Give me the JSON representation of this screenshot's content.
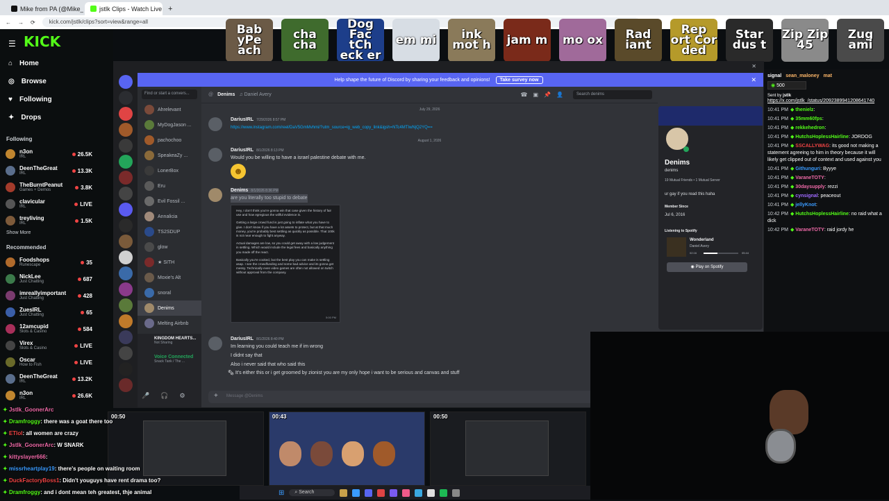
{
  "browser": {
    "tabs": [
      {
        "label": "Mike from PA (@Mike_from_PA",
        "active": false,
        "color": "#111"
      },
      {
        "label": "jstlk Clips - Watch Live on Kick",
        "active": true,
        "color": "#53fc18"
      }
    ],
    "url": "kick.com/jstlk/clips?sort=view&range=all",
    "colors": {
      "chrome": "#dfe3e8"
    }
  },
  "kick": {
    "brand": "KICK",
    "accent": "#53fc18",
    "nav": [
      {
        "label": "Home",
        "icon": "home-icon"
      },
      {
        "label": "Browse",
        "icon": "compass-icon"
      },
      {
        "label": "Following",
        "icon": "heart-icon"
      },
      {
        "label": "Drops",
        "icon": "gift-icon"
      }
    ],
    "following_title": "Following",
    "following": [
      {
        "name": "n3on",
        "cat": "IRL",
        "viewers": "26.5K",
        "color": "#c0862f"
      },
      {
        "name": "DeenTheGreat",
        "cat": "IRL",
        "viewers": "13.3K",
        "color": "#5a6e8c"
      },
      {
        "name": "TheBurntPeanut",
        "cat": "Games + Demos",
        "viewers": "3.8K",
        "color": "#a33b2b"
      },
      {
        "name": "clavicular",
        "cat": "IRL",
        "viewers": "LIVE",
        "color": "#555"
      },
      {
        "name": "treyliving",
        "cat": "IRL",
        "viewers": "1.5K",
        "color": "#7d5a3a"
      }
    ],
    "show_more": "Show More",
    "recommended_title": "Recommended",
    "recommended": [
      {
        "name": "Foodshops",
        "cat": "Runescape",
        "viewers": "35",
        "color": "#b06a2b"
      },
      {
        "name": "NickLee",
        "cat": "Just Chatting",
        "viewers": "687",
        "color": "#3b7a4a"
      },
      {
        "name": "imreallyimportant",
        "cat": "Just Chatting",
        "viewers": "428",
        "color": "#7a3b6e"
      },
      {
        "name": "ZuesIRL",
        "cat": "Just Chatting",
        "viewers": "65",
        "color": "#3a5ea8"
      },
      {
        "name": "12amcupid",
        "cat": "Slots & Casino",
        "viewers": "584",
        "color": "#a82f5a"
      },
      {
        "name": "Virex",
        "cat": "Slots & Casino",
        "viewers": "LIVE",
        "color": "#444"
      },
      {
        "name": "Oscar",
        "cat": "How to Fish",
        "viewers": "LIVE",
        "color": "#6a6a2a"
      },
      {
        "name": "DeenTheGreat",
        "cat": "IRL",
        "viewers": "13.2K",
        "color": "#5a6e8c"
      },
      {
        "name": "n3on",
        "cat": "IRL",
        "viewers": "26.6K",
        "color": "#c0862f"
      }
    ]
  },
  "overlay_emotes": [
    {
      "text": "Bab yPe ach",
      "color": "#6b5a46"
    },
    {
      "text": "cha cha",
      "color": "#3f6b2d"
    },
    {
      "text": "Dog Fac tCh eck er",
      "color": "#1d3e8a"
    },
    {
      "text": "em mi",
      "color": "#d7dde4"
    },
    {
      "text": "ink mot h",
      "color": "#8a7a5a"
    },
    {
      "text": "jam m",
      "color": "#7a2a1a"
    },
    {
      "text": "mo ox",
      "color": "#a06a9a"
    },
    {
      "text": "Rad iant",
      "color": "#5a4a2a"
    },
    {
      "text": "Rep ort Cor ded",
      "color": "#b59a2a"
    },
    {
      "text": "Star dus t",
      "color": "#2a2a2a"
    },
    {
      "text": "Zip Zip 45",
      "color": "#8a8a8a"
    },
    {
      "text": "Zug ami",
      "color": "#4a4a4a"
    }
  ],
  "discord": {
    "banner": "Help shape the future of Discord by sharing your feedback and opinions!",
    "banner_button": "Take survey now",
    "search_dm": "Find or start a convers...",
    "dms": [
      {
        "name": "Ahrelevant",
        "color": "#7a4a3a"
      },
      {
        "name": "MyDogJason ...",
        "color": "#5a7a3a"
      },
      {
        "name": "pachochoo",
        "color": "#a05a2a"
      },
      {
        "name": "SpeakeaZy ...",
        "color": "#8a6a3a"
      },
      {
        "name": "LonerBox",
        "color": "#3a3a3a"
      },
      {
        "name": "Eru",
        "color": "#5a5a5a"
      },
      {
        "name": "Evil Fossil ...",
        "color": "#6a6a6a"
      },
      {
        "name": "Annalicia",
        "color": "#a08a7a"
      },
      {
        "name": "TS2SDUP",
        "color": "#2a4a8a"
      },
      {
        "name": "glow",
        "color": "#4a4a4a"
      },
      {
        "name": "★ SITH",
        "color": "#7a2a2a"
      },
      {
        "name": "Moxie's Alt",
        "color": "#6a5a4a"
      },
      {
        "name": "snoral",
        "color": "#3a6aa8"
      },
      {
        "name": "Denims",
        "color": "#a08a6a"
      },
      {
        "name": "Melting Airbnb",
        "color": "#6a6a8a"
      }
    ],
    "active_dm_sub": "Daniel Avery",
    "melting_sub": "10 Members",
    "server_name": "KINGDOM HEARTS...",
    "server_sub": "Not Sharing",
    "voice_label": "Voice Connected",
    "voice_sub": "Snack Tank / The ...",
    "chat_header": "Denims",
    "chat_header_sub": "Daniel Avery",
    "search_placeholder": "Search denims",
    "date1": "July 29, 2026",
    "date2": "August 1, 2026",
    "msg1_author": "DariusIRL",
    "msg1_time": "7/29/2026 8:57 PM",
    "msg1_text": "https://www.instagram.com/reel/DaV5GmMvhmi/?utm_source=ig_web_copy_link&igsh=NTc4MTIwNjQ2YQ==",
    "msg2_author": "DariusIRL",
    "msg2_time": "8/1/2026 8:13 PM",
    "msg2_text": "Would you be willing to have a israel palestine debate with me.",
    "msg3_author": "Denims",
    "msg3_time": "8/1/2026 8:36 PM",
    "msg3_text": "are you literally too stupid to debate",
    "note_p1": "Hey, I don't think you're gonna win that case given the history of fair use and how egregious the willful evidence is.",
    "note_p2": "Getting a large crowd fund is just going to inflate what you have to give. I don't know if you have a lot assets to protect, but at that much money, you're probably best settling as quickly as possible. That 100k is not near enough to fight anyway.",
    "note_p3": "Actual damages are low, so you could get away with a low judgement in settling. Which would include the legal fees and basically anything you made off the react.",
    "note_p4": "Basically you're cooked, but the best play you can make is settling asap. I see the crowdfunding and some bad advice and its gonna get messy. Technically even video games are often not allowed on twitch without approval from the company.",
    "note_time": "5:00 PM",
    "msg4_author": "DariusIRL",
    "msg4_time": "8/1/2026 8:40 PM",
    "msg4_lines": [
      "Im learning you could teach me if im wrong",
      "I didnt say that",
      "Also i never said that who said this",
      "It's either this or i get groomed by zionist you are my only hope i want to be serious and canvas and stuff"
    ],
    "message_placeholder": "Message @Denims",
    "profile": {
      "name": "Denims",
      "handle": "denims",
      "mutuals": "19 Mutual Friends • 1 Mutual Server",
      "bio": "ur gay if you read this haha",
      "member_since_label": "Member Since",
      "member_since": "Jul 6, 2016",
      "listening_label": "Listening to Spotify",
      "song": "Wonderland",
      "artist": "Daniel Avery",
      "elapsed": "02:16",
      "duration": "05:44",
      "progress": 0.4,
      "play_button": "Play on Spotify"
    },
    "accent": "#5865f2"
  },
  "kick_chat": {
    "top_user": "sean_maloney",
    "top_user2": "mat",
    "pinned_label": "signal",
    "sub_count": "500",
    "sent_by": "Sent by",
    "sent_by_user": "jstlk",
    "pinned_link": "https://x.com/jstlk_/status/2092389941208641740",
    "messages": [
      {
        "time": "10:41 PM",
        "user": "thenielz",
        "text": "",
        "color": "#53fc18"
      },
      {
        "time": "10:41 PM",
        "user": "35mm60fps",
        "text": "",
        "color": "#53fc18"
      },
      {
        "time": "10:41 PM",
        "user": "rekkehedron",
        "text": "",
        "color": "#53fc18"
      },
      {
        "time": "10:41 PM",
        "user": "HutchsHoplessHairline",
        "text": "JORDOG",
        "color": "#53fc18"
      },
      {
        "time": "10:41 PM",
        "user": "SSCALLYWAG",
        "text": "its good not making a statement agreeing to him in theory because it will likely get clipped out of context and used against you",
        "color": "#ef4444"
      },
      {
        "time": "10:41 PM",
        "user": "Githunguri",
        "text": "Byyye",
        "color": "#3a9bff"
      },
      {
        "time": "10:41 PM",
        "user": "VaraneTOTY",
        "text": "",
        "color": "#ef6aa8"
      },
      {
        "time": "10:41 PM",
        "user": "30daysupply",
        "text": "rezzi",
        "color": "#ef6aa8"
      },
      {
        "time": "10:41 PM",
        "user": "cynsignal",
        "text": "peaceout",
        "color": "#a06aff"
      },
      {
        "time": "10:41 PM",
        "user": "jellyKnot",
        "text": "",
        "color": "#3a9bff"
      },
      {
        "time": "10:42 PM",
        "user": "HutchsHoplessHairline",
        "text": "no raid what a dick",
        "color": "#53fc18"
      },
      {
        "time": "10:42 PM",
        "user": "VaraneTOTY",
        "text": "raid jordy he",
        "color": "#ef6aa8"
      }
    ]
  },
  "bottom_chat": [
    {
      "user": "Jstlk_GoonerArc",
      "text": "",
      "color": "#ef6aa8"
    },
    {
      "user": "Dramfroggy",
      "text": ": there was a goat there too",
      "color": "#53fc18"
    },
    {
      "user": "ETlol",
      "text": ": all women are crazy",
      "color": "#ef4444"
    },
    {
      "user": "Jstlk_GoonerArc",
      "text": ": W SNARK",
      "color": "#ef6aa8"
    },
    {
      "user": "kittyslayer666",
      "text": ":",
      "color": "#ef6aa8"
    },
    {
      "user": "missrheartplay19",
      "text": ": there's people on waiting room",
      "color": "#3a9bff"
    },
    {
      "user": "DuckFactoryBoss1",
      "text": ": Didn't youguys have rent drama too?",
      "color": "#ef4444"
    },
    {
      "user": "Dramfroggy",
      "text": ": and i dont mean teh greatest, thje animal",
      "color": "#53fc18"
    }
  ],
  "clips": [
    {
      "time": "00:50",
      "type": "screen"
    },
    {
      "time": "00:43",
      "type": "game"
    },
    {
      "time": "00:50",
      "type": "screen"
    }
  ],
  "viewer_count": "16",
  "taskbar": {
    "search": "Search"
  }
}
